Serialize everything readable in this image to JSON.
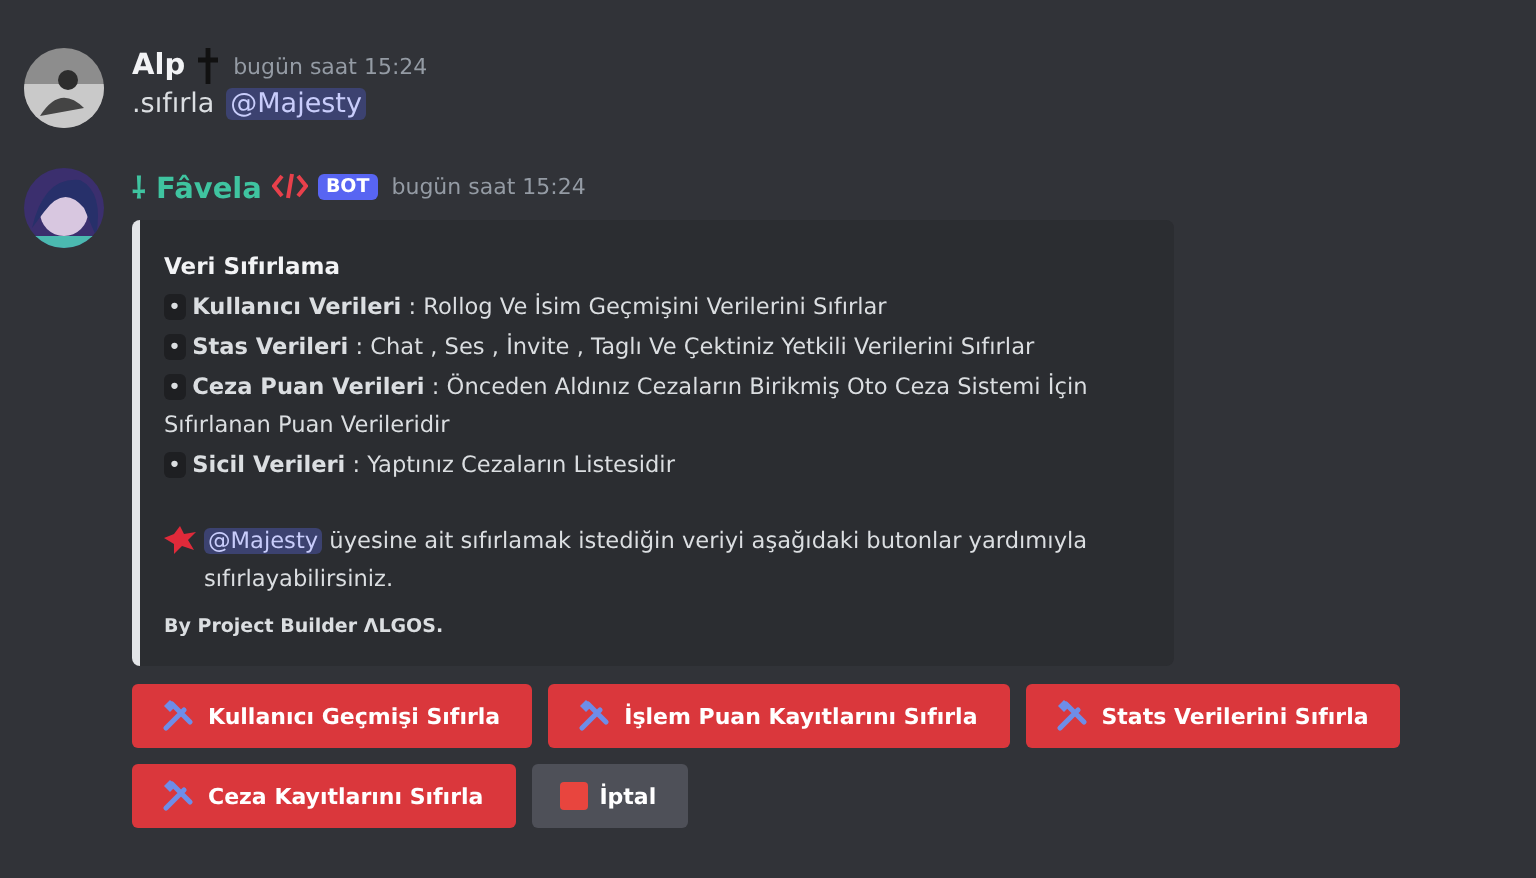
{
  "messages": [
    {
      "author": "Alp",
      "kind": "user",
      "timestamp": "bugün saat 15:24",
      "text": ".sıfırla",
      "mention": "@Majesty"
    },
    {
      "author": "⸸ Fâvela",
      "kind": "bot",
      "badge": "BOT",
      "timestamp": "bugün saat 15:24",
      "embed": {
        "title": "Veri Sıfırlama",
        "fields": [
          {
            "bullet": "•",
            "label": "Kullanıcı Verileri",
            "text": " : Rollog Ve İsim Geçmişini Verilerini Sıfırlar"
          },
          {
            "bullet": "•",
            "label": "Stas Verileri",
            "text": " : Chat , Ses , İnvite , Taglı Ve Çektiniz Yetkili Verilerini Sıfırlar"
          },
          {
            "bullet": "•",
            "label": "Ceza Puan Verileri",
            "text": " : Önceden Aldınız Cezaların Birikmiş Oto Ceza Sistemi İçin Sıfırlanan Puan Verileridir"
          },
          {
            "bullet": "•",
            "label": "Sicil Verileri",
            "text": " : Yaptınız Cezaların Listesidir"
          }
        ],
        "mention": "@Majesty",
        "note": "üyesine ait sıfırlamak istediğin veriyi aşağıdaki butonlar yardımıyla sıfırlayabilirsiniz.",
        "footer": "By Project Builder ΛLGOS."
      },
      "buttons": [
        [
          {
            "label": "Kullanıcı Geçmişi Sıfırla",
            "kind": "danger"
          },
          {
            "label": "İşlem Puan Kayıtlarını Sıfırla",
            "kind": "danger"
          },
          {
            "label": "Stats Verilerini Sıfırla",
            "kind": "danger"
          }
        ],
        [
          {
            "label": "Ceza Kayıtlarını Sıfırla",
            "kind": "danger"
          },
          {
            "label": "İptal",
            "kind": "cancel"
          }
        ]
      ]
    }
  ]
}
